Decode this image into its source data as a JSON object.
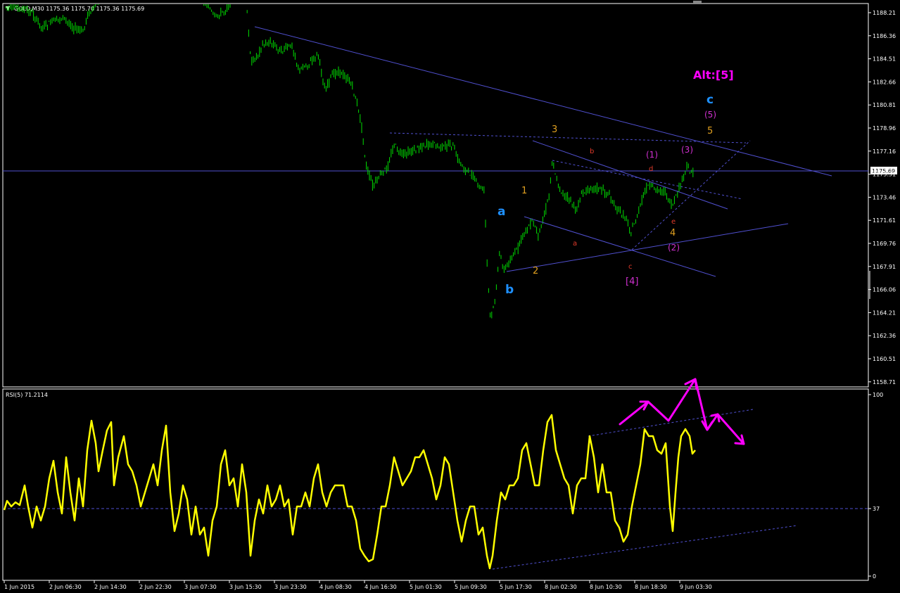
{
  "main_window": {
    "header": "GOLD,M30  1175.36 1175.70 1175.36 1175.69",
    "current_price_label": "1175.69",
    "price_ticks": [
      "1188.21",
      "1186.36",
      "1184.51",
      "1182.66",
      "1180.81",
      "1178.96",
      "1177.16",
      "1175.31",
      "1173.46",
      "1171.61",
      "1169.76",
      "1167.91",
      "1166.06",
      "1164.21",
      "1162.36",
      "1160.51",
      "1158.71"
    ]
  },
  "rsi_window": {
    "header": "RSI(5) 71.2114",
    "ticks": [
      "100",
      "37",
      "0"
    ]
  },
  "time_ticks": [
    "1 Jun 2015",
    "2 Jun 06:30",
    "2 Jun 14:30",
    "2 Jun 22:30",
    "3 Jun 07:30",
    "3 Jun 15:30",
    "3 Jun 23:30",
    "4 Jun 08:30",
    "4 Jun 16:30",
    "5 Jun 01:30",
    "5 Jun 09:30",
    "5 Jun 17:30",
    "8 Jun 02:30",
    "8 Jun 10:30",
    "8 Jun 18:30",
    "9 Jun 03:30"
  ],
  "wave_labels": {
    "alt5": "Alt:[5]",
    "c_big": "c",
    "w5_paren": "(5)",
    "w5_orange": "5",
    "w3_paren": "(3)",
    "w1_paren": "(1)",
    "w3_orange": "3",
    "b_small": "b",
    "d_small": "d",
    "w1_orange": "1",
    "a_big": "a",
    "a_small": "a",
    "c_small": "c",
    "e_small": "e",
    "w4_orange": "4",
    "w2_paren": "(2)",
    "w4_bracket": "[4]",
    "w2_orange": "2",
    "b_big": "b"
  },
  "colors": {
    "background": "#000000",
    "candles": "#00e000",
    "rsi_line": "#ffff00",
    "trendlines": "#5050d0",
    "arrows": "#ff00ff",
    "label_blue": "#1e90ff",
    "label_magenta": "#d030d0",
    "label_orange": "#e0a020",
    "label_red": "#e03a2a"
  }
}
